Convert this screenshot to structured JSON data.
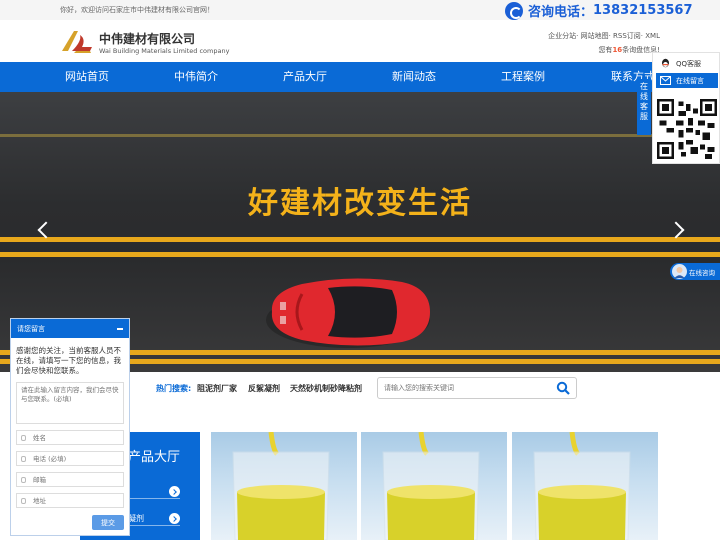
{
  "topbar": {
    "welcome": "你好，欢迎访问石家庄市中伟建材有限公司官网！",
    "hotline_label": "咨询电话：",
    "hotline_number": "13832153567"
  },
  "header": {
    "company_name": "中伟建材有限公司",
    "company_en": "Wai Building Materials Limited company",
    "links": "企业分站· 网站地图· RSS订阅· XML",
    "inquiry_prefix": "您有",
    "inquiry_count": "16",
    "inquiry_suffix": "条询盘信息!"
  },
  "nav": {
    "items": [
      "网站首页",
      "中伟简介",
      "产品大厅",
      "新闻动态",
      "工程案例",
      "联系方式"
    ]
  },
  "banner": {
    "slogan": "好建材改变生活",
    "slide_count": 3
  },
  "search": {
    "hot_label": "热门搜索:",
    "keywords": [
      "阻泥剂厂家",
      "反絮凝剂",
      "天然砂机制砂降粘剂"
    ],
    "placeholder": "请输入您的搜索关键词"
  },
  "products": {
    "panel_title": "产品大厅",
    "categories": [
      "",
      "",
      "凝剂",
      ""
    ]
  },
  "side": {
    "vertical_label": [
      "在",
      "线",
      "客",
      "服"
    ],
    "qq_label": "QQ客服",
    "message_label": "在线留言",
    "consult_label": "在线咨询"
  },
  "message_widget": {
    "title": "请您留言",
    "intro": "感谢您的关注，当前客服人员不在线，请填写一下您的信息，我们会尽快和您联系。",
    "text_placeholder": "请在此输入留言内容，我们会尽快与您联系。(必填)",
    "name_placeholder": "姓名",
    "phone_placeholder": "电话 (必填)",
    "email_placeholder": "邮箱",
    "address_placeholder": "地址",
    "submit_label": "提交"
  },
  "colors": {
    "primary": "#0a6ad6",
    "accent_yellow": "#f4b21a",
    "car_red": "#e0282e"
  }
}
